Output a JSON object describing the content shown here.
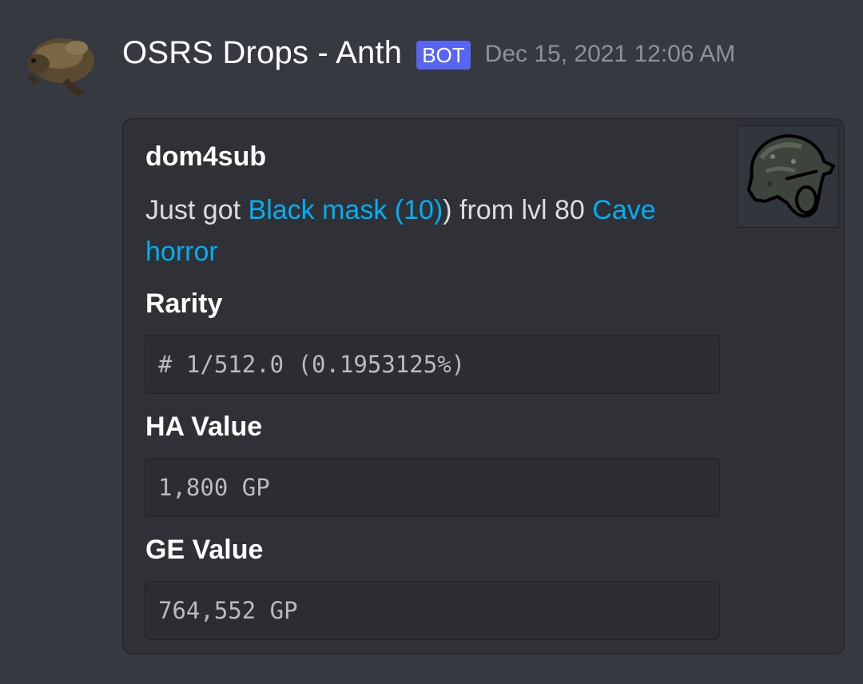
{
  "message": {
    "author": "OSRS Drops - Anth",
    "bot_tag": "BOT",
    "timestamp": "Dec 15, 2021 12:06 AM",
    "avatar_icon": "beaver-avatar-icon"
  },
  "embed": {
    "author": "dom4sub",
    "description": {
      "prefix": "Just got ",
      "item_link": "Black mask (10)",
      "middle": ") from lvl 80 ",
      "monster_link": "Cave horror"
    },
    "thumbnail_icon": "black-mask-icon",
    "fields": [
      {
        "name": "Rarity",
        "value": "# 1/512.0 (0.1953125%)"
      },
      {
        "name": "HA Value",
        "value": "1,800 GP"
      },
      {
        "name": "GE Value",
        "value": "764,552 GP"
      }
    ]
  },
  "colors": {
    "background": "#36393f",
    "embed_background": "#2f3136",
    "link": "#00aff4",
    "bot_tag": "#5865f2",
    "timestamp": "#8e9297"
  }
}
